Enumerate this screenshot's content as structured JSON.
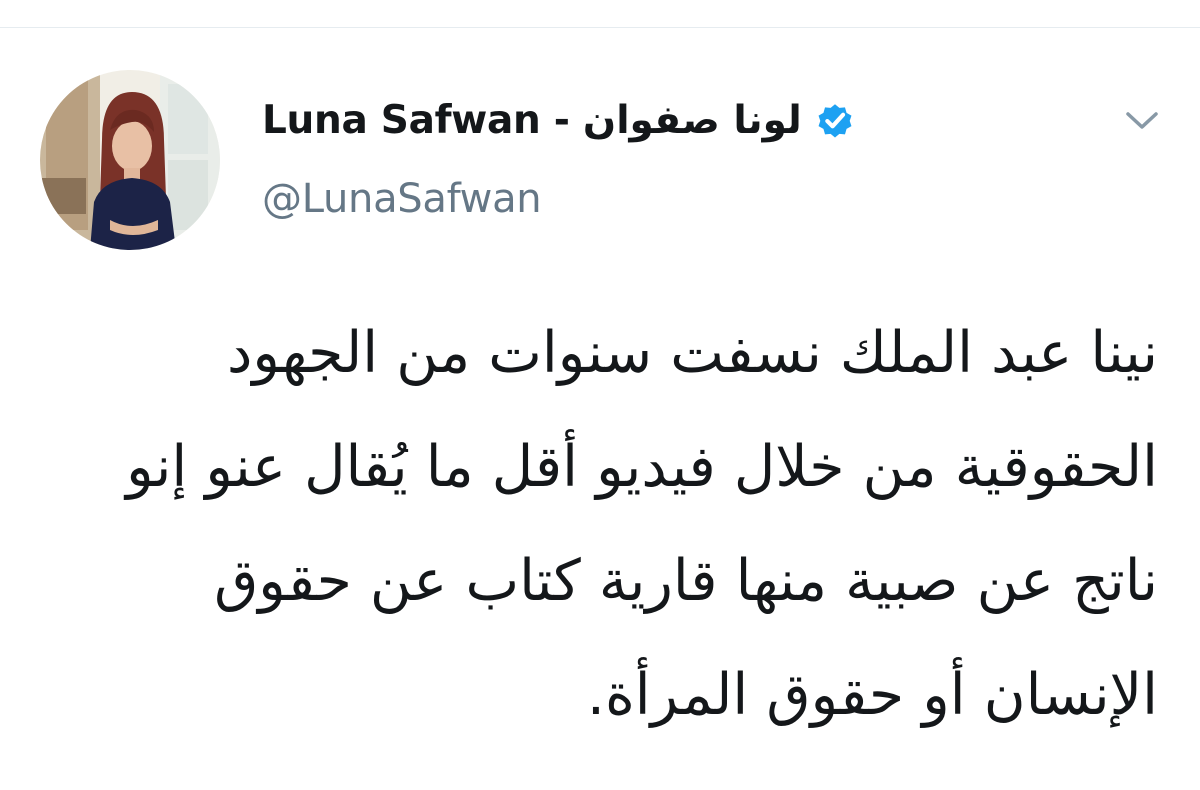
{
  "tweet": {
    "display_name": "Luna Safwan - لونا صفوان",
    "handle": "@LunaSafwan",
    "verified": true,
    "text": "نينا عبد الملك نسفت سنوات من الجهود الحقوقية من خلال فيديو أقل ما يُقال عنو إنو ناتج عن صبية منها قارية كتاب عن حقوق الإنسان أو حقوق المرأة."
  },
  "icons": {
    "verified": "verified-badge-icon",
    "more": "chevron-down-icon"
  },
  "colors": {
    "text_primary": "#14171a",
    "text_secondary": "#657786",
    "verified_blue": "#1da1f2",
    "caret_gray": "#8899a6",
    "divider": "#e6ecf0"
  }
}
